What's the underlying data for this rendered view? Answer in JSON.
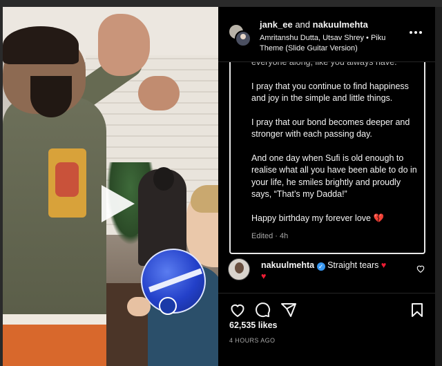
{
  "header": {
    "user_primary": "jank_ee",
    "joiner": "and",
    "user_secondary": "nakuulmehta",
    "audio_line1": "Amritanshu Dutta, Utsav Shrey • Piku",
    "audio_line2": "Theme (Slide Guitar Version)",
    "more_icon": "more-horizontal-icon"
  },
  "caption": {
    "cut_line": "everyone along, like you always have.",
    "paragraphs": [
      "I pray that you continue to find happiness and joy in the simple and little things.",
      "I pray that our bond becomes deeper and stronger with each passing day.",
      "And one day when Sufi is old enough to realise what all you have been able to do in your life, he smiles brightly and proudly says, “That’s my Dadda!”",
      "Happy birthday my forever love 💔"
    ],
    "edited": "Edited · 4h"
  },
  "comment": {
    "user": "nakuulmehta",
    "text": "Straight tears",
    "emoji": "♥",
    "emoji2": "♥"
  },
  "actions": {
    "icons": [
      "heart-icon",
      "comment-icon",
      "share-icon",
      "bookmark-icon"
    ]
  },
  "likes": "62,535 likes",
  "time": "4 HOURS AGO",
  "colors": {
    "background": "#000000",
    "text": "#f5f5f5",
    "muted": "#a8a8a8",
    "verified": "#3897f0",
    "heart": "#ed1c34"
  }
}
